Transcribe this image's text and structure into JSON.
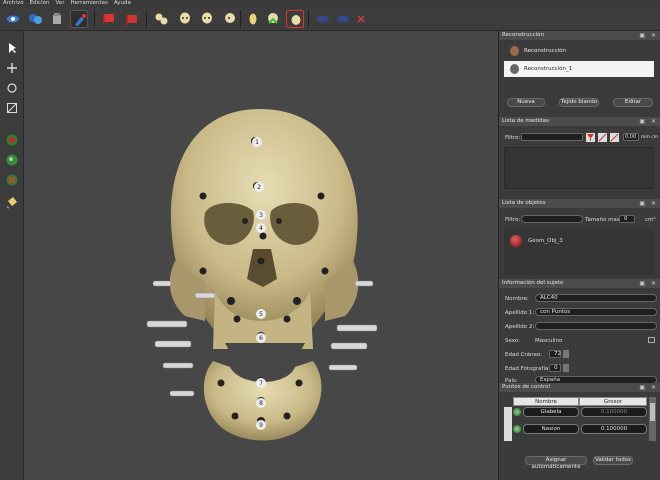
{
  "menu": [
    "Archivo",
    "Edición",
    "Ver",
    "Herramientas",
    "Ayuda"
  ],
  "toolbar_icons": [
    "eye-icon",
    "color-eye-icon",
    "paint-icon",
    "brush-icon",
    "flag-icon",
    "flag-alt-icon",
    "skull-group-icon",
    "skull-icon",
    "skull-side-icon",
    "skull-tilt-icon",
    "skull-egg-icon",
    "skull-green-icon",
    "skull-frame-icon",
    "link-icon",
    "link-alt-icon",
    "close-icon"
  ],
  "left_tools": [
    "select-arrow-icon",
    "move-icon",
    "rotate-icon",
    "measure-icon",
    "sphere-red-icon",
    "sphere-green-icon",
    "sphere-x-icon",
    "paint-bucket-icon"
  ],
  "viewport": {
    "points": [
      "1",
      "2",
      "3",
      "4",
      "5",
      "6",
      "7",
      "8",
      "9"
    ]
  },
  "reconstruccion": {
    "title": "Reconstrucción",
    "items": [
      "Reconstrucción",
      "Reconstrucción_1"
    ],
    "buttons": [
      "Nueva",
      "Tejido blando",
      "Editar"
    ]
  },
  "medidas": {
    "title": "Lista de medidas",
    "filter_label": "Filtro:",
    "value": "0,00",
    "unit": "mm cm"
  },
  "objetos": {
    "title": "Lista de objetos",
    "filter_label": "Filtro:",
    "size_label": "Tamaño max:",
    "size_value": "0",
    "size_unit": "cm³",
    "item": "Geom_Obj_3"
  },
  "sujeto": {
    "title": "Información del sujeto",
    "nombre_label": "Nombre:",
    "nombre": "ALC40",
    "apellido1_label": "Apellido 1:",
    "apellido1": "con Puntos",
    "apellido2_label": "Apellido 2:",
    "apellido2": "",
    "sexo_label": "Sexo:",
    "sexo": "Masculino",
    "edad_craneo_label": "Edad Cráneo:",
    "edad_craneo": "72",
    "edad_foto_label": "Edad Fotografía:",
    "edad_foto": "0",
    "pais_label": "País:",
    "pais": "España"
  },
  "puntos": {
    "title": "Puntos de control",
    "headers": [
      "Nombre",
      "Grosor"
    ],
    "rows": [
      {
        "name": "Glabela",
        "value": "0.100000"
      },
      {
        "name": "Nasion",
        "value": "0.100000"
      }
    ],
    "buttons": [
      "Asignar automáticamente",
      "Validar todos"
    ]
  },
  "colors": {
    "accent": "#ffffff",
    "bone": "#cdbf8e",
    "panel_bg": "#3b3b3b",
    "viewport_bg": "#474747"
  }
}
